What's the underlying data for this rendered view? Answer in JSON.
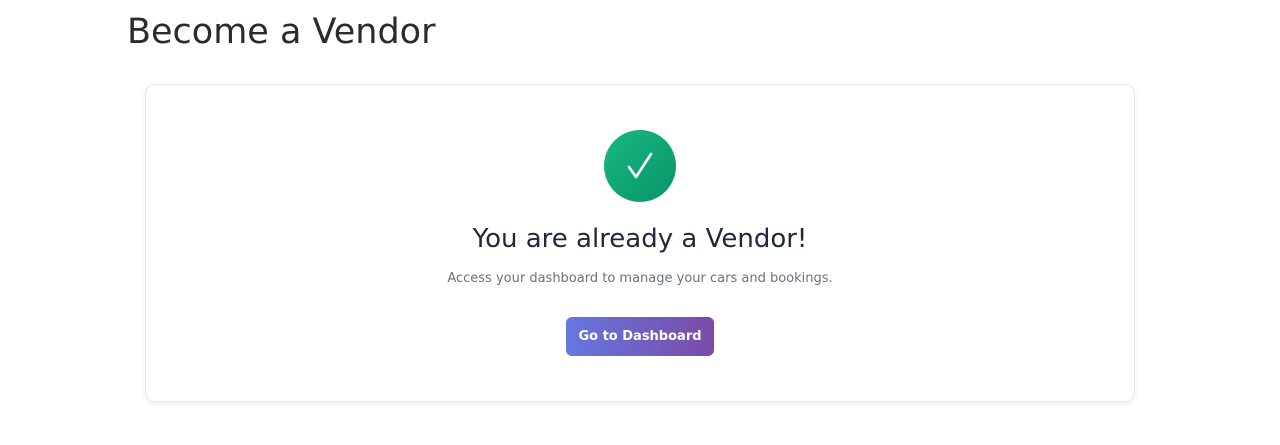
{
  "page": {
    "title": "Become a Vendor"
  },
  "card": {
    "icon": "checkmark-icon",
    "heading": "You are already a Vendor!",
    "subtext": "Access your dashboard to manage your cars and bookings.",
    "button_label": "Go to Dashboard"
  },
  "colors": {
    "success_green": "#12a877",
    "button_gradient_start": "#6677e0",
    "button_gradient_end": "#7a4ba6",
    "heading_text": "#1f2937",
    "subtext": "#6b7280"
  }
}
